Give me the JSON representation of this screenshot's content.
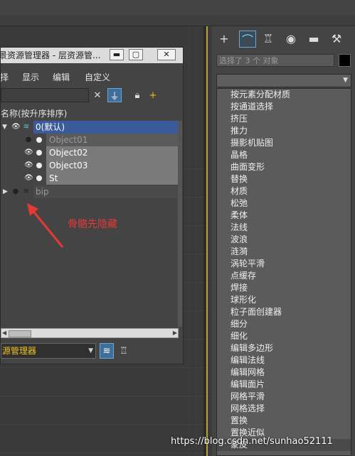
{
  "explorer": {
    "title": "场景资源管理器 - 层资源管...",
    "title_visible": "景资源管理器 - 层资源管...",
    "window_buttons": {
      "minimize": "▬",
      "maximize": "▢",
      "close": "✕"
    },
    "menu": [
      "择",
      "显示",
      "编辑",
      "自定义"
    ],
    "column_header": "名称(按升序排序)",
    "tree": [
      {
        "label": "0(默认)",
        "level": 0,
        "expanded": true,
        "selected": true
      },
      {
        "label": "Object01",
        "level": 1,
        "hidden": true
      },
      {
        "label": "Object02",
        "level": 1,
        "highlighted": true
      },
      {
        "label": "Object03",
        "level": 1,
        "highlighted": true
      },
      {
        "label": "St",
        "level": 1,
        "highlighted": true
      },
      {
        "label": "bip",
        "level": 0,
        "expanded": false,
        "hidden": true
      }
    ],
    "bottom_dropdown": "源管理器"
  },
  "annotation": "骨骼先隐藏",
  "command_panel": {
    "selection_info": "选择了 3 个 对象",
    "modifier_list": [
      "按元素分配材质",
      "按通道选择",
      "挤压",
      "推力",
      "摄影机贴图",
      "晶格",
      "曲面变形",
      "替换",
      "材质",
      "松弛",
      "柔体",
      "法线",
      "波浪",
      "涟漪",
      "涡轮平滑",
      "点缓存",
      "焊接",
      "球形化",
      "粒子面创建器",
      "细分",
      "细化",
      "编辑多边形",
      "编辑法线",
      "编辑网格",
      "编辑面片",
      "网格平滑",
      "网格选择",
      "置换",
      "置换近似",
      "蒙皮"
    ]
  },
  "watermark": "https://blog.csdn.net/sunhao52111",
  "colors": {
    "selected_row": "#3a5a9a",
    "highlighted_row": "#7a7a7a",
    "annotation": "#e53935",
    "dropdown_text": "#f0c020",
    "active_tool": "#3f6f98"
  },
  "icons": {
    "command_tabs": [
      "plus-icon",
      "curve-icon",
      "hierarchy-icon",
      "motion-icon",
      "display-icon",
      "wrench-icon"
    ]
  }
}
